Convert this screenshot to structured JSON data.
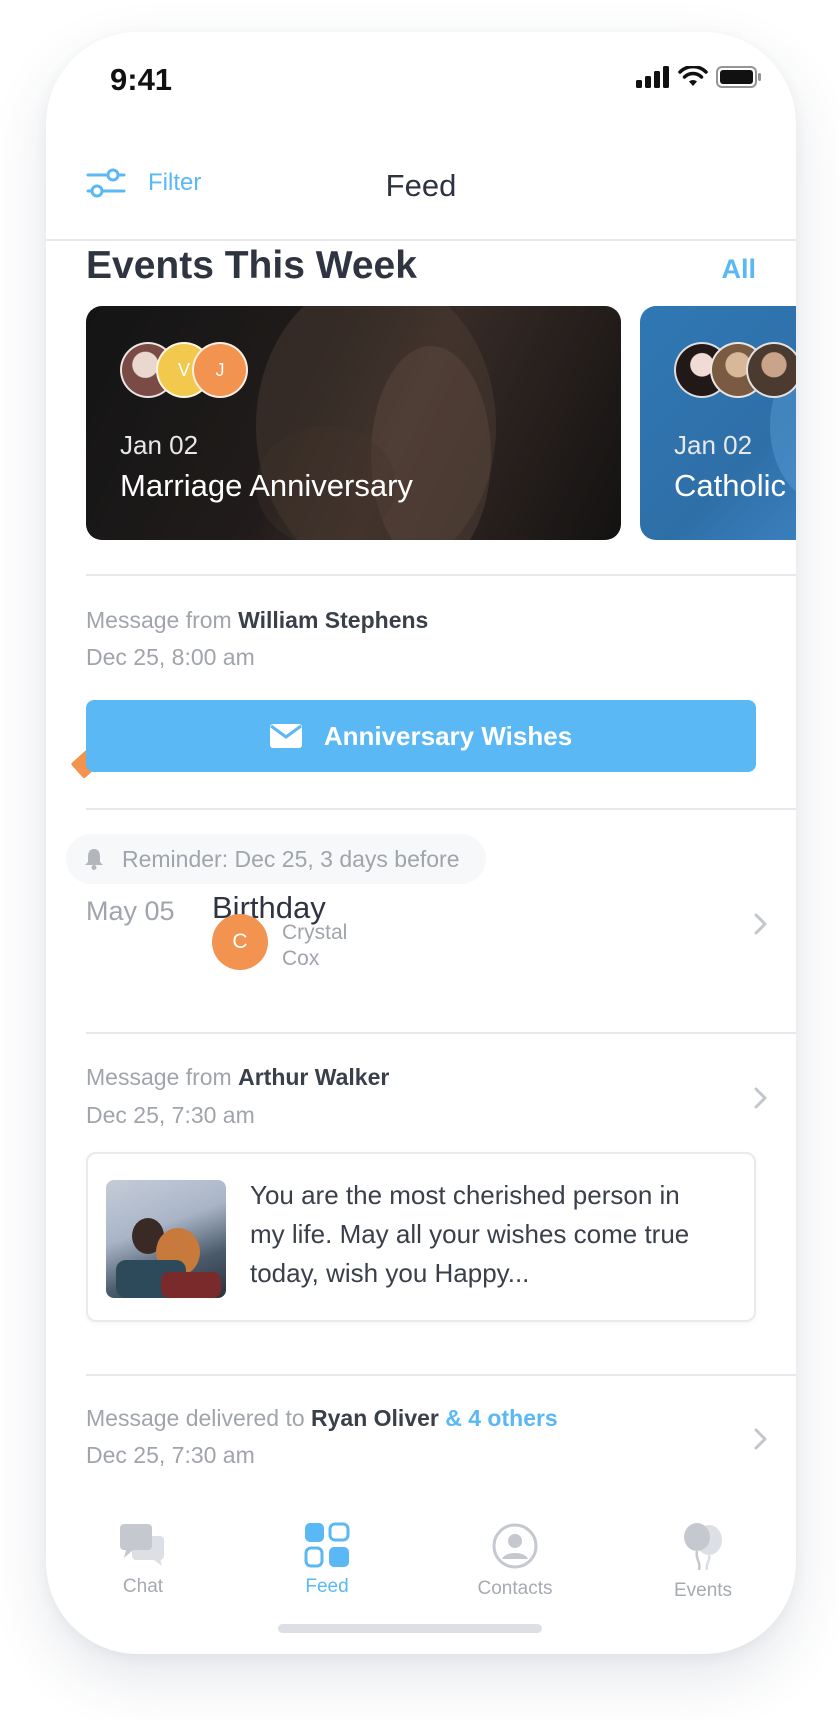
{
  "status_bar": {
    "time": "9:41"
  },
  "nav": {
    "filter_label": "Filter",
    "title": "Feed"
  },
  "events_section": {
    "title": "Events This Week",
    "all_link": "All",
    "cards": [
      {
        "date": "Jan 02",
        "title": "Marriage Anniversary",
        "avatars": [
          "",
          "V",
          "J"
        ]
      },
      {
        "date": "Jan 02",
        "title": "Catholic",
        "avatars": [
          "",
          "",
          ""
        ]
      }
    ]
  },
  "feed": {
    "message1": {
      "prefix": "Message from",
      "sender": "William Stephens",
      "timestamp": "Dec 25, 8:00 am",
      "button_label": "Anniversary Wishes"
    },
    "reminder": {
      "label": "Reminder: Dec 25, 3 days before",
      "event_date": "May 05",
      "event_title": "Birthday",
      "person_initial": "C",
      "person_first": "Crystal",
      "person_last": "Cox"
    },
    "message2": {
      "prefix": "Message from",
      "sender": "Arthur Walker",
      "timestamp": "Dec 25, 7:30 am",
      "text": "You are the most cherished person in my life. May all your wishes come true today, wish you Happy..."
    },
    "message3": {
      "prefix": "Message delivered to",
      "recipient": "Ryan Oliver",
      "others": "& 4 others",
      "timestamp": "Dec 25, 7:30 am"
    }
  },
  "tab_bar": {
    "tabs": [
      {
        "label": "Chat",
        "icon": "chat-icon",
        "active": false
      },
      {
        "label": "Feed",
        "icon": "feed-icon",
        "active": true
      },
      {
        "label": "Contacts",
        "icon": "contacts-icon",
        "active": false
      },
      {
        "label": "Events",
        "icon": "balloons-icon",
        "active": false
      }
    ]
  },
  "colors": {
    "accent": "#5ab8f4",
    "orange": "#f29350",
    "text_dark": "#2f3540",
    "text_muted": "#a0a4ab"
  }
}
